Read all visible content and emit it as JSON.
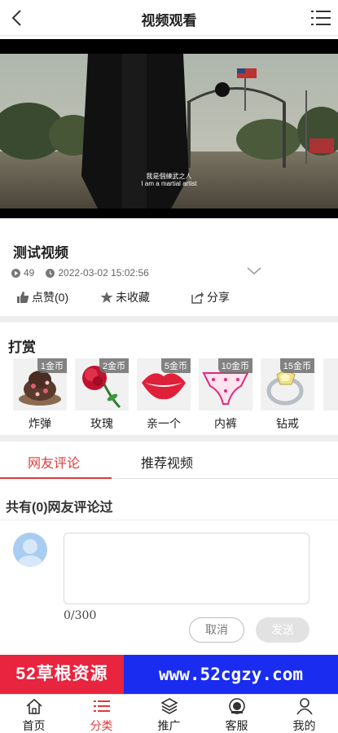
{
  "header": {
    "title": "视频观看"
  },
  "video": {
    "subtitle_cn": "我是個練武之人",
    "subtitle_en": "I am a martial artist"
  },
  "info": {
    "title": "测试视频",
    "views": "49",
    "datetime": "2022-03-02 15:02:56",
    "like_label": "点赞(0)",
    "collect_label": "未收藏",
    "share_label": "分享"
  },
  "reward": {
    "title": "打赏",
    "gifts": [
      {
        "name": "炸弹",
        "price": "1金币"
      },
      {
        "name": "玫瑰",
        "price": "2金币"
      },
      {
        "name": "亲一个",
        "price": "5金币"
      },
      {
        "name": "内裤",
        "price": "10金币"
      },
      {
        "name": "钻戒",
        "price": "15金币"
      }
    ]
  },
  "tabs": [
    {
      "label": "网友评论",
      "active": true
    },
    {
      "label": "推荐视频",
      "active": false
    }
  ],
  "comments": {
    "count_text": "共有(0)网友评论过",
    "char_counter": "0/300",
    "cancel_label": "取消",
    "send_label": "发送"
  },
  "banner": {
    "left_text": "52草根资源",
    "right_text": "www.52cgzy.com"
  },
  "nav": [
    {
      "label": "首页",
      "icon": "home-icon"
    },
    {
      "label": "分类",
      "icon": "list-icon",
      "active": true
    },
    {
      "label": "推广",
      "icon": "layers-icon"
    },
    {
      "label": "客服",
      "icon": "service-icon"
    },
    {
      "label": "我的",
      "icon": "user-icon"
    }
  ],
  "colors": {
    "accent": "#e03a3a",
    "banner_red": "#e8243e",
    "banner_blue": "#1a2cf0"
  }
}
